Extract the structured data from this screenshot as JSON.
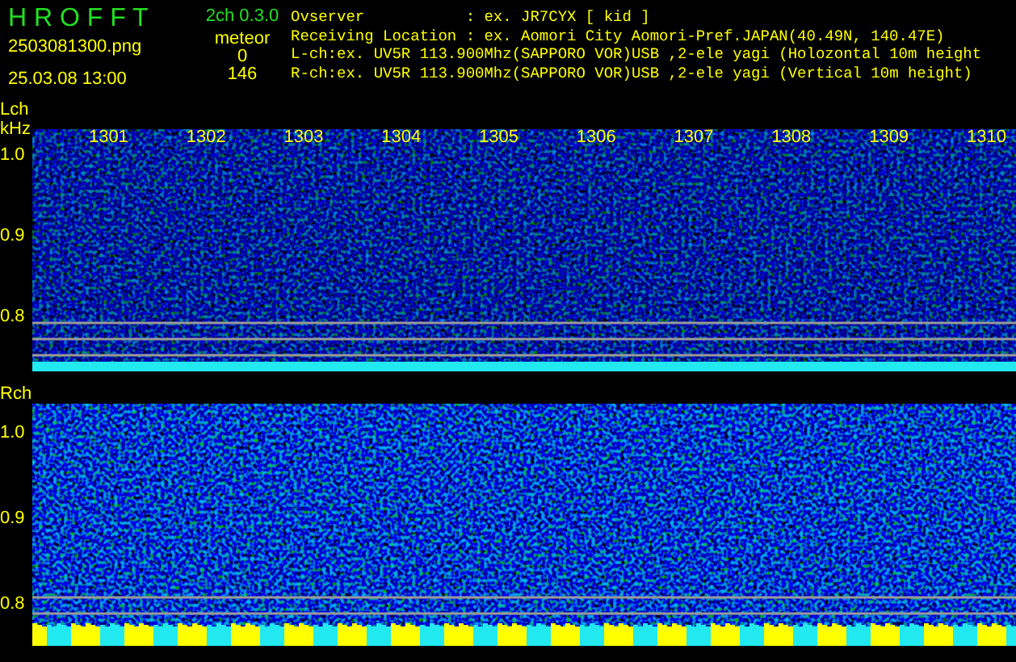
{
  "header": {
    "app_title": "H R O F F T",
    "file_name": "2503081300.png",
    "timestamp": "25.03.08 13:00",
    "version": "2ch 0.3.0",
    "counter_label": "meteor",
    "counts": [
      "0",
      "146"
    ],
    "info_lines": [
      {
        "kind": "field",
        "label": "Ovserver",
        "value": ": ex. JR7CYX [ kid ]"
      },
      {
        "kind": "field",
        "label": "Receiving Location",
        "value": ": ex. Aomori City Aomori-Pref.JAPAN(40.49N, 140.47E)"
      },
      {
        "kind": "channel",
        "label": "L-ch:",
        "value": "ex. UV5R 113.900Mhz(SAPPORO VOR)USB ,2-ele yagi (Holozontal 10m height"
      },
      {
        "kind": "channel",
        "label": "R-ch:",
        "value": "ex. UV5R 113.900Mhz(SAPPORO VOR)USB ,2-ele yagi (Vertical 10m height)"
      }
    ]
  },
  "panels": [
    {
      "kind": "lch",
      "label": "Lch",
      "unit": "kHz",
      "time_labels": [
        "1301",
        "1302",
        "1303",
        "1304",
        "1305",
        "1306",
        "1307",
        "1308",
        "1309",
        "1310"
      ],
      "freq_labels": [
        "1.0",
        "0.9",
        "0.8"
      ]
    },
    {
      "kind": "rch",
      "label": "Rch",
      "freq_labels": [
        "1.0",
        "0.9",
        "0.8"
      ]
    }
  ]
}
